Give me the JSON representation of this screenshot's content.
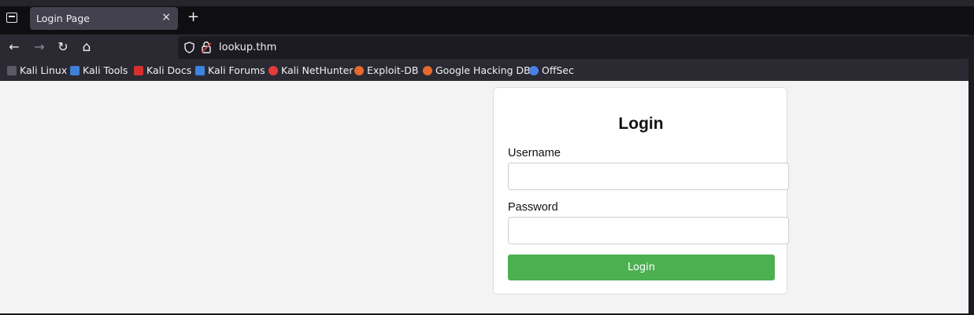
{
  "browser": {
    "tab": {
      "title": "Login Page",
      "close": "×"
    },
    "new_tab": "+",
    "url": "lookup.thm",
    "nav": {
      "back": "←",
      "forward": "→",
      "reload": "↻",
      "home": "⌂"
    },
    "bookmarks": [
      {
        "label": "Kali Linux",
        "icon": "kali-dragon-icon",
        "color": "#5a5a66"
      },
      {
        "label": "Kali Tools",
        "icon": "kali-tools-icon",
        "color": "#3f7fd6"
      },
      {
        "label": "Kali Docs",
        "icon": "kali-docs-icon",
        "color": "#d62f2f"
      },
      {
        "label": "Kali Forums",
        "icon": "kali-forums-icon",
        "color": "#3b84e0"
      },
      {
        "label": "Kali NetHunter",
        "icon": "kali-nethunter-icon",
        "color": "#e23b3b"
      },
      {
        "label": "Exploit-DB",
        "icon": "exploit-db-icon",
        "color": "#e66a2c"
      },
      {
        "label": "Google Hacking DB",
        "icon": "ghdb-icon",
        "color": "#e66a2c"
      },
      {
        "label": "OffSec",
        "icon": "offsec-icon",
        "color": "#4a7fe8"
      }
    ]
  },
  "login": {
    "heading": "Login",
    "username_label": "Username",
    "username_value": "",
    "password_label": "Password",
    "password_value": "",
    "submit_label": "Login",
    "button_color": "#4caf50"
  }
}
